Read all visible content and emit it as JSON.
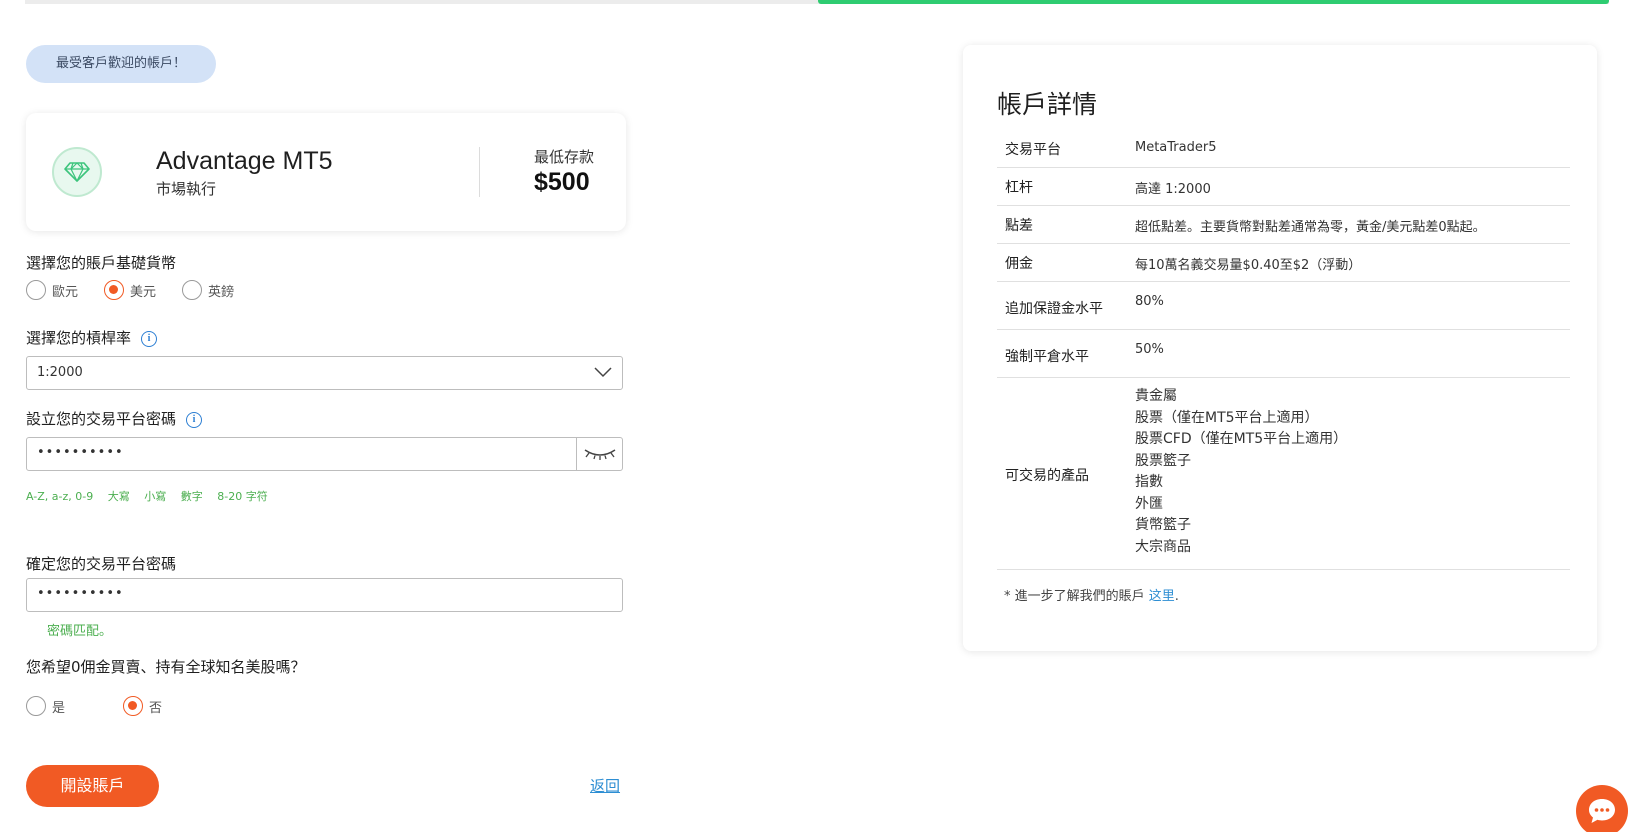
{
  "colors": {
    "accent": "#f15a24",
    "success": "#2ecc71",
    "link": "#2d8ed3",
    "pill_bg": "#d3e2f7"
  },
  "progress": {
    "fraction": 0.5
  },
  "popular_badge": "最受客戶歡迎的帳戶！",
  "account": {
    "name": "Advantage MT5",
    "execution": "市場執行",
    "min_deposit_label": "最低存款",
    "min_deposit_value": "$500",
    "icon": "diamond-icon"
  },
  "currency": {
    "label": "選擇您的賬戶基礎貨幣",
    "options": [
      {
        "label": "歐元",
        "checked": false
      },
      {
        "label": "美元",
        "checked": true
      },
      {
        "label": "英鎊",
        "checked": false
      }
    ]
  },
  "leverage": {
    "label": "選擇您的槓桿率",
    "value": "1:2000"
  },
  "password": {
    "label": "設立您的交易平台密碼",
    "value": "••••••••••",
    "hints": [
      "A-Z, a-z, 0-9",
      "大寫",
      "小寫",
      "數字",
      "8-20 字符"
    ]
  },
  "confirm_password": {
    "label": "確定您的交易平台密碼",
    "value": "••••••••••",
    "match_message": "密碼匹配。"
  },
  "us_stocks": {
    "question": "您希望0佣金買賣、持有全球知名美股嗎？",
    "options": [
      {
        "label": "是",
        "checked": false
      },
      {
        "label": "否",
        "checked": true
      }
    ]
  },
  "actions": {
    "open_account": "開設賬戶",
    "back": "返回"
  },
  "details": {
    "title": "帳戶詳情",
    "rows": [
      {
        "key": "交易平台",
        "value": "MetaTrader5"
      },
      {
        "key": "杠杆",
        "value": "高達 1:2000"
      },
      {
        "key": "點差",
        "value": "超低點差。主要貨幣對點差通常為零，黃金/美元點差0點起。"
      },
      {
        "key": "佣金",
        "value": "每10萬名義交易量$0.40至$2（浮動）"
      },
      {
        "key": "追加保證金水平",
        "value": "80%"
      },
      {
        "key": "強制平倉水平",
        "value": "50%"
      }
    ],
    "products_label": "可交易的產品",
    "products": [
      "貴金屬",
      "股票（僅在MT5平台上適用）",
      "股票CFD（僅在MT5平台上適用）",
      "股票籃子",
      "指數",
      "外匯",
      "貨幣籃子",
      "大宗商品"
    ],
    "footnote_text": "* 進一步了解我們的賬戶 ",
    "footnote_link": "这里",
    "footnote_end": "."
  },
  "chat": {
    "icon": "chat-icon"
  }
}
